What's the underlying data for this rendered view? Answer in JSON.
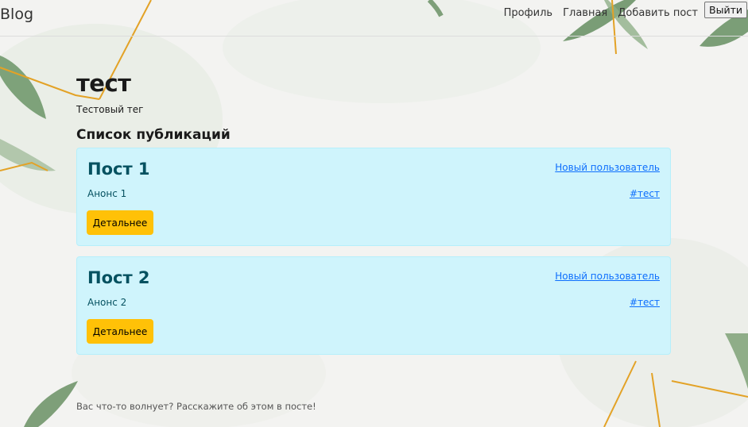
{
  "navbar": {
    "brand": "Blog",
    "links": [
      "Профиль",
      "Главная",
      "Добавить пост"
    ],
    "logout_label": "Выйти"
  },
  "tag": {
    "title": "тест",
    "description": "Тестовый тег"
  },
  "posts_heading": "Список публикаций",
  "posts": [
    {
      "title": "Пост 1",
      "announce": "Анонс 1",
      "author": "Новый пользователь",
      "tag": "#тест",
      "button": "Детальнее"
    },
    {
      "title": "Пост 2",
      "announce": "Анонс 2",
      "author": "Новый пользователь",
      "tag": "#тест",
      "button": "Детальнее"
    }
  ],
  "footer": "Вас что-то волнует? Расскажите об этом в посте!",
  "colors": {
    "card_background": "#cff4fc",
    "card_text": "#055160",
    "button": "#ffc107",
    "link": "#0d6efd"
  }
}
